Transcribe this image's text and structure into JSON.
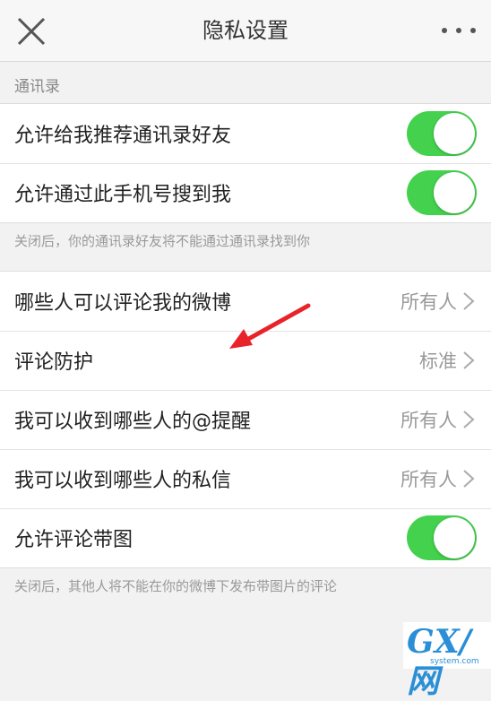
{
  "header": {
    "title": "隐私设置",
    "close_icon": "close-icon",
    "more_icon": "more-dots-icon"
  },
  "contacts_section": {
    "label": "通讯录",
    "rows": [
      {
        "label": "允许给我推荐通讯录好友",
        "toggle": true
      },
      {
        "label": "允许通过此手机号搜到我",
        "toggle": true
      }
    ],
    "note": "关闭后，你的通讯录好友将不能通过通讯录找到你"
  },
  "interaction_section": {
    "rows": [
      {
        "label": "哪些人可以评论我的微博",
        "value": "所有人"
      },
      {
        "label": "评论防护",
        "value": "标准"
      },
      {
        "label": "我可以收到哪些人的@提醒",
        "value": "所有人"
      },
      {
        "label": "我可以收到哪些人的私信",
        "value": "所有人"
      }
    ],
    "image_comment": {
      "label": "允许评论带图",
      "toggle": true
    },
    "note": "关闭后，其他人将不能在你的微博下发布带图片的评论"
  },
  "colors": {
    "toggle_on": "#44d14d",
    "annotation_arrow": "#e8232a",
    "watermark": "#2a8fd6"
  },
  "watermark": {
    "logo": "GX/网",
    "url": "system.com"
  }
}
